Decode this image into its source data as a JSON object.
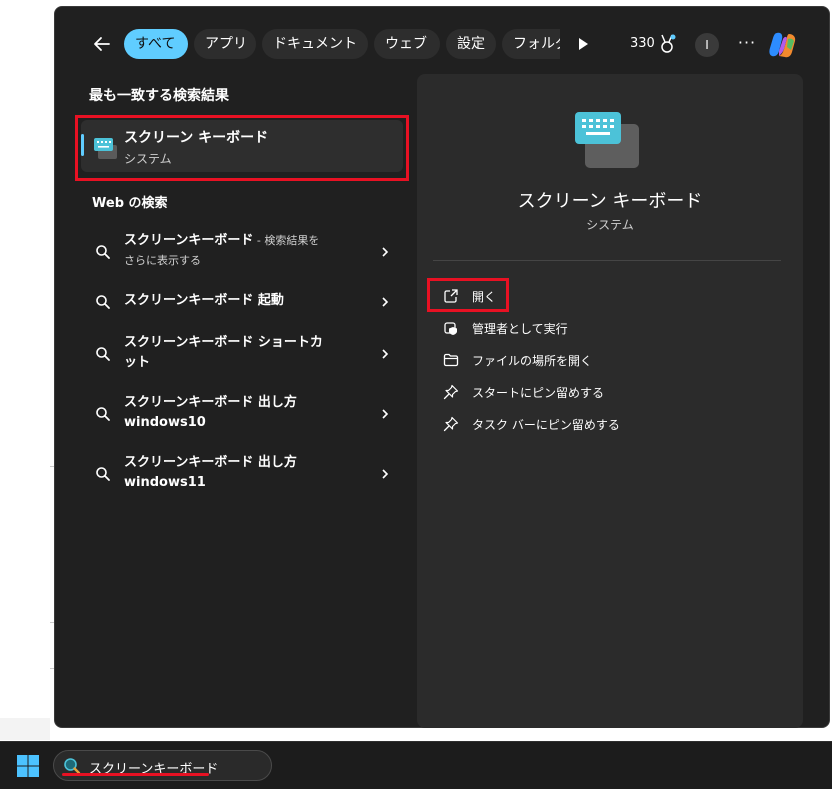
{
  "topbar": {
    "filters": [
      "すべて",
      "アプリ",
      "ドキュメント",
      "ウェブ",
      "設定",
      "フォルダー"
    ],
    "active_filter": "すべて",
    "points": "330",
    "avatar_initial": "I"
  },
  "best_match": {
    "heading": "最も一致する検索結果",
    "title": "スクリーン キーボード",
    "subtitle": "システム"
  },
  "web": {
    "heading": "Web の検索",
    "items": [
      {
        "main": "スクリーンキーボード",
        "suffix": " - 検索結果を",
        "line2": "さらに表示する"
      },
      {
        "main": "スクリーンキーボード 起動",
        "suffix": "",
        "line2": ""
      },
      {
        "main": "スクリーンキーボード ショートカ",
        "suffix": "",
        "line2": "ット"
      },
      {
        "main": "スクリーンキーボード 出し方",
        "suffix": "",
        "line2": "windows10"
      },
      {
        "main": "スクリーンキーボード 出し方",
        "suffix": "",
        "line2": "windows11"
      }
    ]
  },
  "preview": {
    "title": "スクリーン キーボード",
    "subtitle": "システム",
    "actions": [
      {
        "label": "開く",
        "icon": "open-external-icon"
      },
      {
        "label": "管理者として実行",
        "icon": "admin-shield-icon"
      },
      {
        "label": "ファイルの場所を開く",
        "icon": "folder-icon"
      },
      {
        "label": "スタートにピン留めする",
        "icon": "pin-icon"
      },
      {
        "label": "タスク バーにピン留めする",
        "icon": "pin-icon"
      }
    ]
  },
  "taskbar": {
    "search_value": "スクリーンキーボード"
  },
  "colors": {
    "accent": "#60cdff",
    "highlight": "#e81123",
    "panel": "#202020"
  }
}
